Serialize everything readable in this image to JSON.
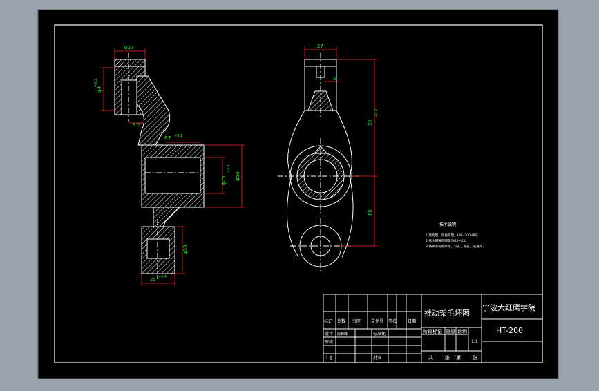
{
  "colors": {
    "background_outer": "#9aa3ae",
    "sheet": "#000000",
    "line": "#ffffff",
    "dimension": "#ff2020",
    "dimension_text": "#22ee22",
    "centerline": "#ffffff"
  },
  "dimensions": {
    "side_top_width": "φ27",
    "side_top_height": "φ4",
    "side_tol_upper": "+0.2",
    "side_tol_lower": "0",
    "side_offset": "9.5",
    "side_bore_label": "R7",
    "side_bore_tol": "+0.1",
    "side_bore_diameter": "φ25",
    "side_bore_dia_tol": "+0.1",
    "side_outer_diameter": "φ50",
    "side_bottom_height": "φ35",
    "side_bottom_width": "25",
    "side_bottom_tol": "+0.4",
    "front_top_width": "27",
    "front_slot": "5",
    "front_height": "90",
    "front_height_tol": "+0.2",
    "front_lower": "60"
  },
  "notes": {
    "heading": "技术说明",
    "line1": "1.热处理，调质处理，HB=200HBS。",
    "line2": "2.未注明铸造圆角为R3~R5。",
    "line3": "3.铸件不得有砂眼，气孔，缩孔，夹渣等。"
  },
  "title_block": {
    "drawing_title": "推动架毛坯图",
    "school": "宁波大红鹰学院",
    "material": "HT-200",
    "col_mark": "标记",
    "col_count": "处数",
    "col_zone": "分区",
    "col_doc": "文件号",
    "col_sign": "签名",
    "col_date": "日期",
    "row_design": "设计",
    "designer": "周锦峰",
    "row_standard": "标准化",
    "row_review": "审核",
    "row_process": "工艺",
    "row_approve": "批准",
    "stage_mark": "阶段标记",
    "weight": "重量",
    "scale": "比例",
    "scale_value": "1:1",
    "sheets_total": "共",
    "sheets_unit": "张",
    "sheet_no": "第",
    "sheet_unit": "张"
  }
}
